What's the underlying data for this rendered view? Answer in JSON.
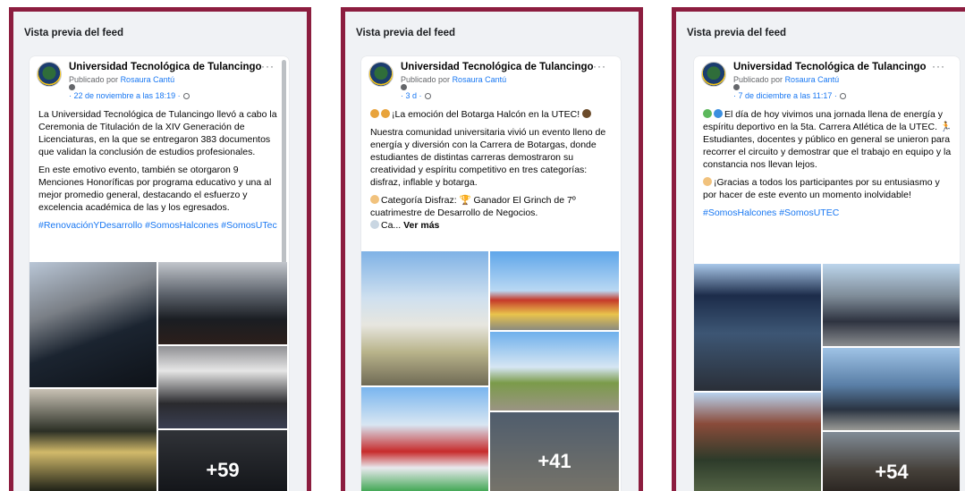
{
  "panel_title": "Vista previa del feed",
  "colors": {
    "frame": "#8c1d3f",
    "link": "#1877f2",
    "secondary": "#65676b"
  },
  "icons": {
    "options": "more-options-icon",
    "audience": "globe-icon",
    "avatar": "university-logo"
  },
  "posts": [
    {
      "page_name": "Universidad Tecnológica de Tulancingo",
      "published_by": "Publicado por",
      "author": "Rosaura Cantú",
      "date": "· 22 de noviembre a las 18:19 ·",
      "more": "···",
      "paragraph1": "La Universidad Tecnológica de Tulancingo llevó a cabo la Ceremonia de Titulación de la XIV Generación de Licenciaturas, en la que se entregaron 383 documentos que validan la conclusión de estudios profesionales.",
      "paragraph2": "En este emotivo evento, también se otorgaron 9 Menciones Honoríficas por programa educativo y una al mejor promedio general, destacando el esfuerzo y excelencia académica de las y los egresados.",
      "hashtags": "#RenovaciónYDesarrollo #SomosHalcones #SomosUTec",
      "photo_count": "+59"
    },
    {
      "page_name": "Universidad Tecnológica de Tulancingo",
      "published_by": "Publicado por",
      "author": "Rosaura Cantú",
      "date": "· 3 d ·",
      "more": "···",
      "headline": "¡La emoción del Botarga Halcón en la UTEC!",
      "paragraph1": "Nuestra comunidad universitaria vivió un evento lleno de energía y diversión con la Carrera de Botargas, donde estudiantes de distintas carreras demostraron su creatividad y espíritu competitivo en tres categorías: disfraz, inflable y botarga.",
      "paragraph2": "Categoría Disfraz: 🏆 Ganador El Grinch de 7º cuatrimestre de Desarrollo de Negocios.",
      "truncated": "Ca...",
      "see_more": "Ver más",
      "photo_count": "+41"
    },
    {
      "page_name": "Universidad Tecnológica de Tulancingo",
      "published_by": "Publicado por",
      "author": "Rosaura Cantú",
      "date": "· 7 de diciembre a las 11:17 ·",
      "more": "···",
      "paragraph1": "El día de hoy vivimos una jornada llena de energía y espíritu deportivo en la 5ta. Carrera Atlética de la UTEC. 🏃 Estudiantes, docentes y público en general se unieron para recorrer el circuito y demostrar que el trabajo en equipo y la constancia nos llevan lejos.",
      "paragraph2": "¡Gracias a todos los participantes por su entusiasmo y por hacer de este evento un momento inolvidable!",
      "hashtags": "#SomosHalcones #SomosUTEC",
      "photo_count": "+54"
    }
  ]
}
